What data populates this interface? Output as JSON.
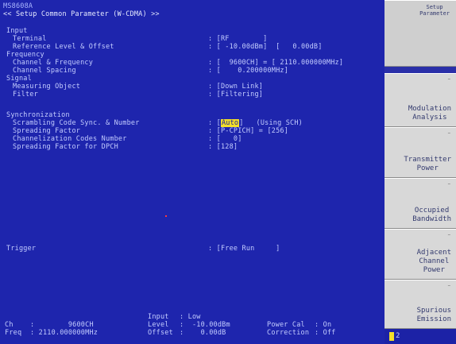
{
  "app": {
    "model": "MS8608A"
  },
  "header": {
    "title": "<< Setup Common Parameter (W-CDMA) >>"
  },
  "params": {
    "input_label": "Input",
    "terminal_label": "Terminal",
    "terminal_value": ": [RF        ]",
    "ref_level_label": "Reference Level & Offset",
    "ref_level_value": ": [ -10.00dBm]  [   0.00dB]",
    "frequency_label": "Frequency",
    "channel_freq_label": "Channel & Frequency",
    "channel_freq_value": ": [  9600CH] = [ 2110.000000MHz]",
    "channel_spacing_label": "Channel Spacing",
    "channel_spacing_value": ": [    0.200000MHz]",
    "signal_label": "Signal",
    "measuring_object_label": "Measuring Object",
    "measuring_object_value": ": [Down Link]",
    "filter_label": "Filter",
    "filter_value": ": [Filtering]",
    "sync_label": "Synchronization",
    "scrambling_label": "Scrambling Code Sync. & Number",
    "scrambling_prefix": ": [",
    "scrambling_highlight": "Auto",
    "scrambling_suffix": "]   (Using SCH)",
    "spreading_factor_label": "Spreading Factor",
    "spreading_factor_value": ": [P-CPICH] = [256]",
    "chan_codes_label": "Channelization Codes Number",
    "chan_codes_value": ": [   0]",
    "sf_dpch_label": "Spreading Factor for DPCH",
    "sf_dpch_value": ": [128]",
    "trigger_label": "Trigger",
    "trigger_value": ": [Free Run     ]"
  },
  "status_bar": {
    "input_label": "Input",
    "input_value": ": Low",
    "ch_label": "Ch",
    "ch_value": ":        9600CH",
    "level_label": "Level",
    "level_value": ":  -10.00dBm",
    "power_cal_label": "Power Cal",
    "power_cal_value": ": On",
    "freq_label": "Freq",
    "freq_value": ": 2110.000000MHz",
    "offset_label": "Offset",
    "offset_value": ":    0.00dB",
    "correction_label": "Correction",
    "correction_value": ": Off"
  },
  "softkeys": {
    "top": "Setup\nParameter",
    "k1": "Modulation\nAnalysis",
    "k1_underline": "A",
    "k2": "Transmitter\nPower",
    "k3": "Occupied\nBandwidth",
    "k4": "Adjacent\nChannel\nPower",
    "k5": "Spurious\nEmission",
    "status_marker": "2"
  },
  "colors": {
    "background": "#1e25ad",
    "text": "#c3ccff",
    "highlight": "#f3df2a",
    "softkey_bg": "#d8d8d8"
  }
}
